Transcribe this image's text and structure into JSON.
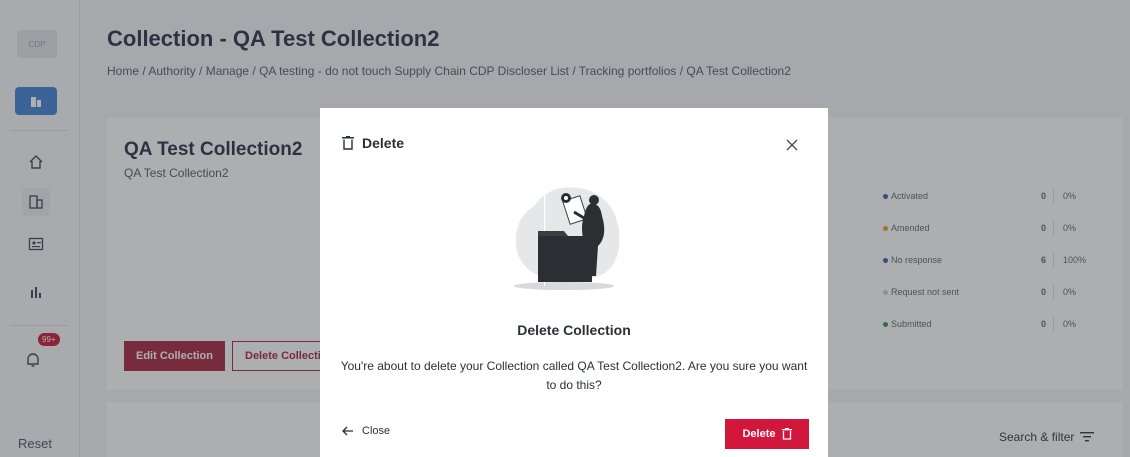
{
  "sidebar": {
    "logo_text": "CDP",
    "notification_badge": "99+",
    "reset_label": "Reset"
  },
  "header": {
    "title": "Collection - QA Test Collection2",
    "breadcrumb": "Home / Authority / Manage / QA testing - do not touch Supply Chain CDP Discloser List / Tracking portfolios / QA Test Collection2"
  },
  "card": {
    "title": "QA Test Collection2",
    "subtitle": "QA Test Collection2",
    "edit_label": "Edit Collection",
    "delete_label": "Delete Collection"
  },
  "stats": [
    {
      "label": "Activated",
      "count": "0",
      "percent": "0%",
      "color": "#2f5fb3"
    },
    {
      "label": "Amended",
      "count": "0",
      "percent": "0%",
      "color": "#e0a020"
    },
    {
      "label": "No response",
      "count": "6",
      "percent": "100%",
      "color": "#2f5fb3"
    },
    {
      "label": "Request not sent",
      "count": "0",
      "percent": "0%",
      "color": "#c9ccd1"
    },
    {
      "label": "Submitted",
      "count": "0",
      "percent": "0%",
      "color": "#2e8b57"
    }
  ],
  "toolbar": {
    "search_filter_label": "Search & filter"
  },
  "modal": {
    "header_title": "Delete",
    "title": "Delete Collection",
    "body": "You're about to delete your Collection called QA Test Collection2. Are you sure you want to do this?",
    "close_label": "Close",
    "delete_label": "Delete"
  },
  "colors": {
    "primary_dark": "#a0203a",
    "danger": "#d3173c",
    "accent_blue": "#3d7fd6"
  }
}
